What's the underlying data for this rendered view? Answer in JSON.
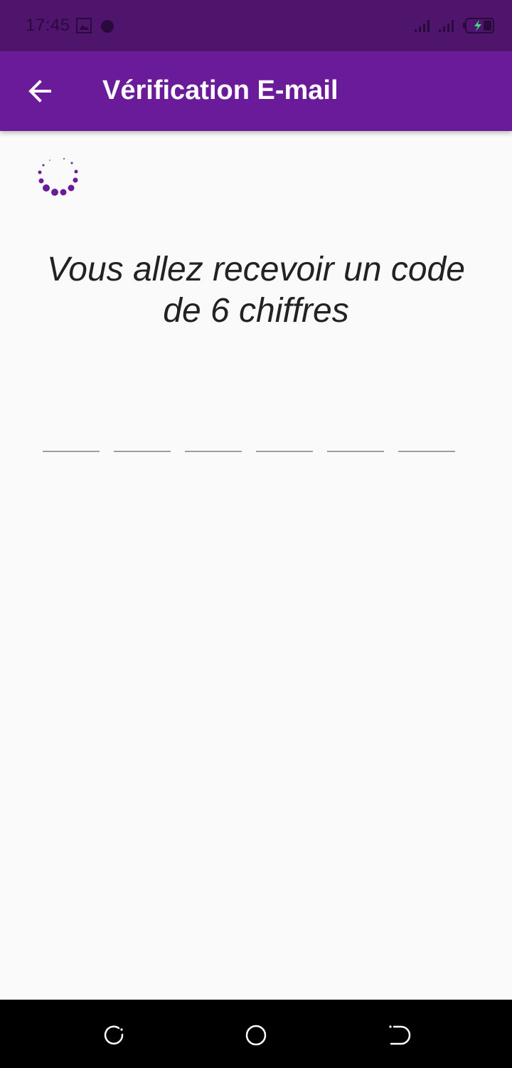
{
  "status_bar": {
    "time": "17:45",
    "icons": [
      "image-icon",
      "circle-dot-icon",
      "signal-icon",
      "signal-icon",
      "battery-charging-icon"
    ],
    "background": "#4f146b"
  },
  "app_bar": {
    "title": "Vérification E-mail",
    "background": "#6a1b9a",
    "back_icon": "arrow-left-icon"
  },
  "main": {
    "spinner_color": "#6a1b9a",
    "message": "Vous allez recevoir un code de 6 chiffres",
    "code_digits": [
      "",
      "",
      "",
      "",
      "",
      ""
    ]
  },
  "nav_bar": {
    "icons": [
      "recent-apps-icon",
      "home-icon",
      "back-icon"
    ]
  }
}
